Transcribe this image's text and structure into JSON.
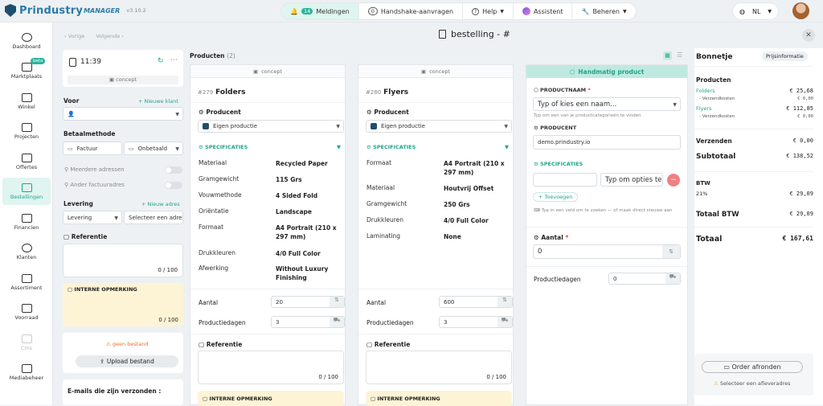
{
  "app": {
    "name": "Prindustry",
    "suffix": "MANAGER",
    "version": "v3.10.2"
  },
  "topbar": {
    "notifications_count": "14",
    "notifications_label": "Meldingen",
    "handshake_count": "0",
    "handshake_label": "Handshake-aanvragen",
    "help_label": "Help",
    "assistant_label": "Assistent",
    "manage_label": "Beheren",
    "language": "NL"
  },
  "sidebar": {
    "beta_badge": "beta",
    "items": [
      {
        "label": "Dashboard"
      },
      {
        "label": "Marktplaats"
      },
      {
        "label": "Winkel"
      },
      {
        "label": "Projecten"
      },
      {
        "label": "Offertes"
      },
      {
        "label": "Bestellingen"
      },
      {
        "label": "Financien"
      },
      {
        "label": "Klanten"
      },
      {
        "label": "Assortiment"
      },
      {
        "label": "Voorraad"
      },
      {
        "label": "Cms"
      },
      {
        "label": "Mediabeheer"
      }
    ]
  },
  "subbar": {
    "prev": "Vorige",
    "next": "Volgende",
    "title": "bestelling - #"
  },
  "left": {
    "time": "11:39",
    "status": "concept",
    "voor_label": "Voor",
    "new_client": "Nieuwe klant",
    "payment_label": "Betaalmethode",
    "payment_method": "Factuur",
    "payment_status": "Onbetaald",
    "multi_addr": "Meerdere adressen",
    "other_invoice": "Ander factuuradres",
    "delivery_label": "Levering",
    "new_address": "Nieuw adres",
    "delivery_value": "Levering",
    "address_placeholder": "Selecteer een adres",
    "reference_label": "Referentie",
    "reference_count": "0 / 100",
    "internal_label": "INTERNE OPMERKING",
    "internal_count": "0 / 100",
    "no_file": "geen bestand",
    "upload": "Upload bestand",
    "emails_label": "E-mails die zijn verzonden :"
  },
  "products": {
    "label": "Producten",
    "count": "(2)"
  },
  "product1": {
    "status": "concept",
    "id": "#279",
    "name": "Folders",
    "producer_label": "Producent",
    "producer": "Eigen productie",
    "specs_label": "SPECIFICATIES",
    "specs": [
      {
        "k": "Materiaal",
        "v": "Recycled Paper"
      },
      {
        "k": "Gramgewicht",
        "v": "115 Grs"
      },
      {
        "k": "Vouwmethode",
        "v": "4 Sided Fold"
      },
      {
        "k": "Oriëntatie",
        "v": "Landscape"
      },
      {
        "k": "Formaat",
        "v": "A4 Portrait (210 x 297 mm)"
      },
      {
        "k": "Drukkleuren",
        "v": "4/0 Full Color"
      },
      {
        "k": "Afwerking",
        "v": "Without Luxury Finishing"
      }
    ],
    "qty_label": "Aantal",
    "qty": "20",
    "days_label": "Productiedagen",
    "days": "3",
    "ref_label": "Referentie",
    "ref_count": "0 / 100",
    "internal_label": "INTERNE OPMERKING"
  },
  "product2": {
    "status": "concept",
    "id": "#280",
    "name": "Flyers",
    "producer_label": "Producent",
    "producer": "Eigen productie",
    "specs_label": "SPECIFICATIES",
    "specs": [
      {
        "k": "Formaat",
        "v": "A4 Portrait (210 x 297 mm)"
      },
      {
        "k": "Materiaal",
        "v": "Houtvrij Offset"
      },
      {
        "k": "Gramgewicht",
        "v": "250 Grs"
      },
      {
        "k": "Drukkleuren",
        "v": "4/0 Full Color"
      },
      {
        "k": "Laminating",
        "v": "None"
      }
    ],
    "qty_label": "Aantal",
    "qty": "600",
    "days_label": "Productiedagen",
    "days": "3",
    "ref_label": "Referentie",
    "ref_count": "0 / 100",
    "internal_label": "INTERNE OPMERKING"
  },
  "manual": {
    "header": "Handmatig product",
    "name_label": "PRODUCTNAAM",
    "name_placeholder": "Typ of kies een naam...",
    "name_hint": "Typ om een van je productcategorieën te vinden",
    "producer_label": "PRODUCENT",
    "producer_value": "demo.prindustry.io",
    "specs_label": "SPECIFICATIES",
    "options_placeholder": "Typ om opties te zoeken",
    "add_label": "Toevoegen",
    "specs_hint": "Typ in een veld om te zoeken — of maak direct nieuwe aan",
    "qty_label": "Aantal",
    "qty": "0",
    "days_label": "Productiedagen",
    "days": "0"
  },
  "receipt": {
    "title": "Bonnetje",
    "info_button": "Prijsinformatie",
    "products_label": "Producten",
    "items": [
      {
        "name": "Folders",
        "price": "€ 25,68",
        "sub": "- Verzendkosten",
        "sub_price": "€ 0,00"
      },
      {
        "name": "Flyers",
        "price": "€ 112,85",
        "sub": "- Verzendkosten",
        "sub_price": "€ 0,00"
      }
    ],
    "shipping_label": "Verzenden",
    "shipping": "€ 0,00",
    "subtotal_label": "Subtotaal",
    "subtotal": "€ 138,52",
    "btw_label": "BTW",
    "btw_rate": "21%",
    "btw": "€ 29,09",
    "total_btw_label": "Totaal BTW",
    "total_btw": "€ 29,09",
    "total_label": "Totaal",
    "total": "€ 167,61",
    "order_button": "Order afronden",
    "warning": "Selecteer een afleveradres"
  },
  "colors": {
    "accent": "#20a58b",
    "brand": "#2b7aa8",
    "note_bg": "#fdf4d6"
  }
}
